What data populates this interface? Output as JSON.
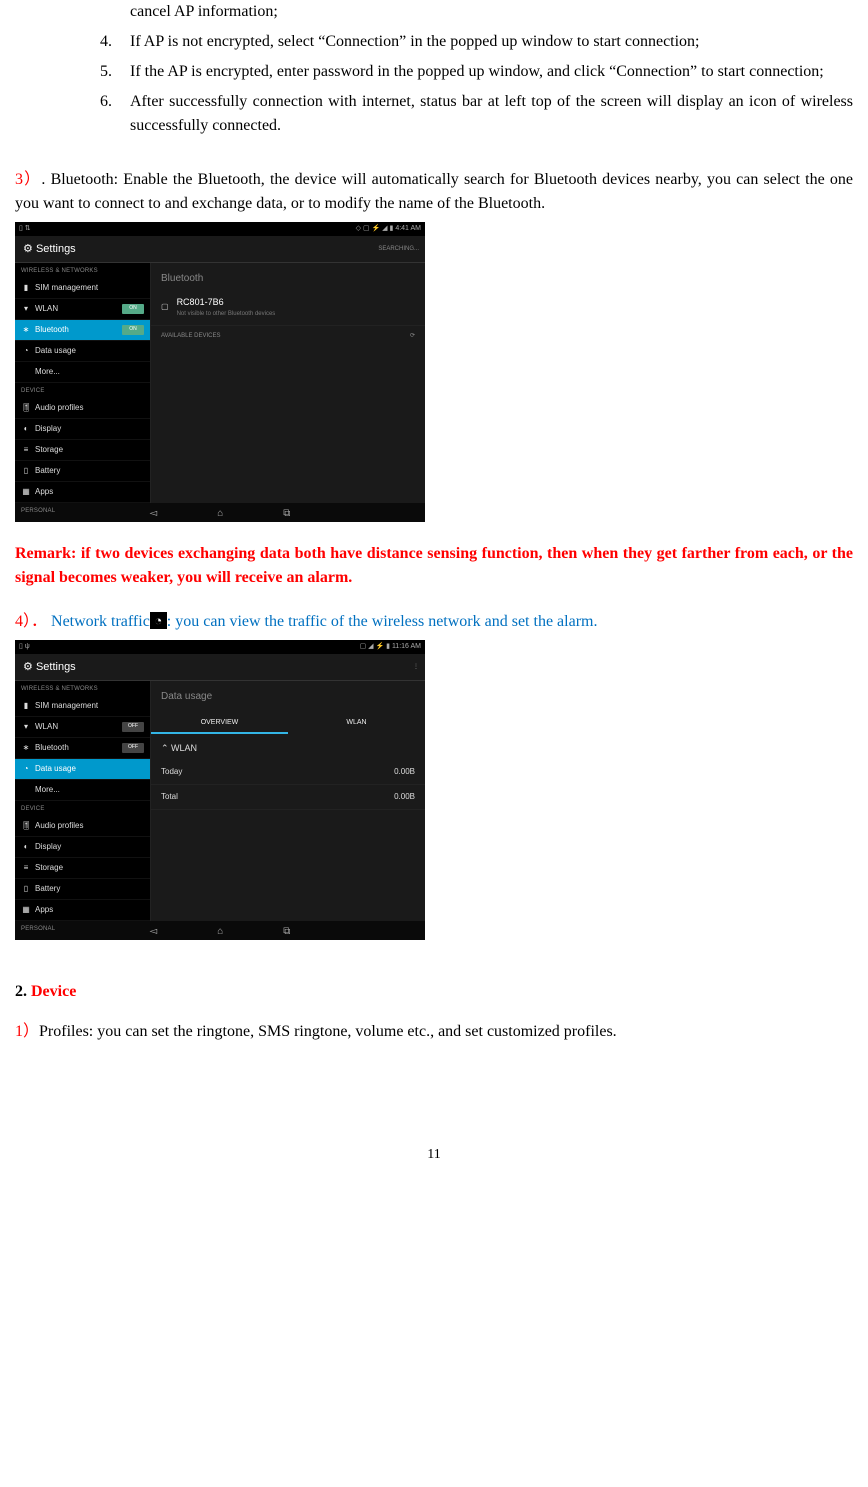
{
  "ol": {
    "partial": "cancel AP information;",
    "items": [
      {
        "n": "4.",
        "t": "If AP is not encrypted, select “Connection” in the popped up window to start connection;"
      },
      {
        "n": "5.",
        "t": "If the AP is encrypted, enter password in the popped up window, and click “Connection” to start connection;"
      },
      {
        "n": "6.",
        "t": "After successfully connection with internet, status bar at left top of the screen will display an icon of wireless successfully connected."
      }
    ]
  },
  "p3": {
    "pre": "3）",
    "dot": ". ",
    "body": "Bluetooth: Enable the Bluetooth, the device will automatically search for Bluetooth devices nearby, you can select the one you want to connect to and exchange data, or to modify the name of the Bluetooth."
  },
  "remark": "Remark: if two devices exchanging data both have distance sensing function, then when they get farther from each, or the signal becomes weaker, you will receive an alarm.",
  "p4": {
    "pre": "4）．",
    "left": "Network traffic",
    "right": ": you can view the traffic of the wireless network and set the alarm."
  },
  "sec2": {
    "num": "2.",
    "title": "Device",
    "sub": {
      "pre": "1）",
      "body": "Profiles: you can set the ringtone, SMS ringtone, volume etc., and set customized profiles."
    }
  },
  "pg": "11",
  "ss1": {
    "settings": "Settings",
    "searching": "SEARCHING...",
    "time": "4:41 AM",
    "cat_wn": "WIRELESS & NETWORKS",
    "cat_dv": "DEVICE",
    "cat_ps": "PERSONAL",
    "sim": "SIM management",
    "wlan": "WLAN",
    "bt": "Bluetooth",
    "du": "Data usage",
    "more": "More...",
    "audio": "Audio profiles",
    "display": "Display",
    "storage": "Storage",
    "battery": "Battery",
    "apps": "Apps",
    "on": "ON",
    "btc_title": "Bluetooth",
    "dev_name": "RC801-7B6",
    "dev_sub": "Not visible to other Bluetooth devices",
    "avail": "AVAILABLE DEVICES"
  },
  "ss2": {
    "settings": "Settings",
    "time": "11:16 AM",
    "cat_wn": "WIRELESS & NETWORKS",
    "cat_dv": "DEVICE",
    "cat_ps": "PERSONAL",
    "sim": "SIM management",
    "wlan": "WLAN",
    "bt": "Bluetooth",
    "du": "Data usage",
    "more": "More...",
    "audio": "Audio profiles",
    "display": "Display",
    "storage": "Storage",
    "battery": "Battery",
    "apps": "Apps",
    "off": "OFF",
    "du_title": "Data usage",
    "tab_ov": "OVERVIEW",
    "tab_wl": "WLAN",
    "wlan_head": "WLAN",
    "today": "Today",
    "total": "Total",
    "v_today": "0.00B",
    "v_total": "0.00B"
  }
}
